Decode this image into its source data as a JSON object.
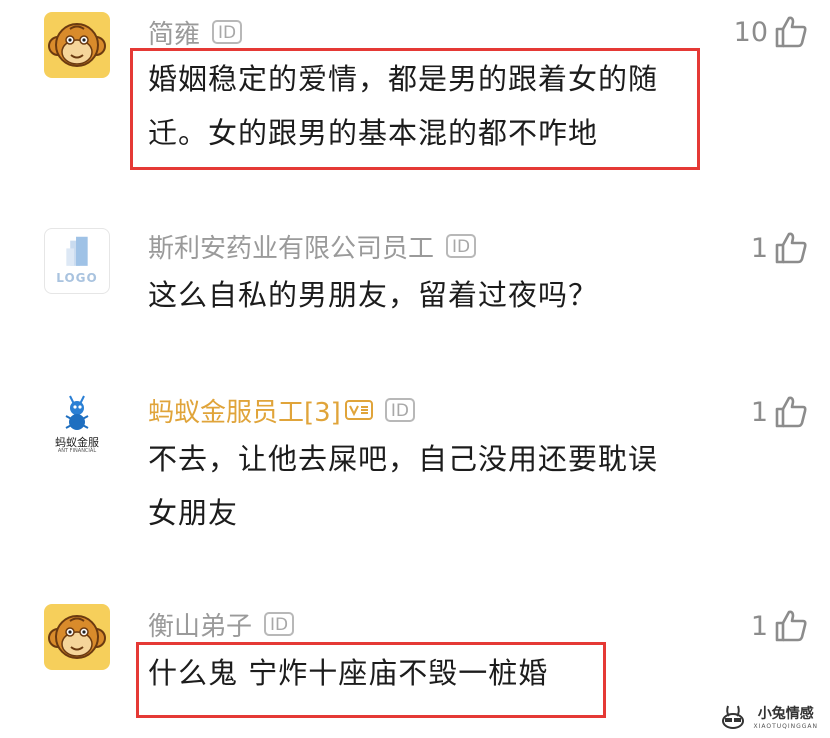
{
  "comments": [
    {
      "username": "简雍",
      "id_badge": "ID",
      "likes": "10",
      "lines": [
        "婚姻稳定的爱情，都是男的跟着女的随",
        "迁。女的跟男的基本混的都不咋地"
      ]
    },
    {
      "username": "斯利安药业有限公司员工",
      "id_badge": "ID",
      "likes": "1",
      "avatar_text": "LOGO",
      "lines": [
        "这么自私的男朋友，留着过夜吗？"
      ]
    },
    {
      "username": "蚂蚁金服员工[3]",
      "id_badge": "ID",
      "likes": "1",
      "avatar_text": "蚂蚁金服",
      "avatar_subtext": "ANT FINANCIAL",
      "lines": [
        "不去，让他去屎吧，自己没用还要耽误",
        "女朋友"
      ]
    },
    {
      "username": "衡山弟子",
      "id_badge": "ID",
      "likes": "1",
      "lines": [
        "什么鬼 宁炸十座庙不毁一桩婚"
      ]
    }
  ],
  "watermark": {
    "title": "小兔情感",
    "subtitle": "XIAOTUQINGGAN"
  },
  "colors": {
    "highlight": "#e53935",
    "username_gray": "#9a9a9a",
    "username_gold": "#e0a43a",
    "avatar_yellow": "#f6cf5b"
  },
  "icons": {
    "like": "thumbs-up-icon",
    "avatar1": "monkey-avatar-icon",
    "avatar4": "monkey-avatar-icon"
  }
}
